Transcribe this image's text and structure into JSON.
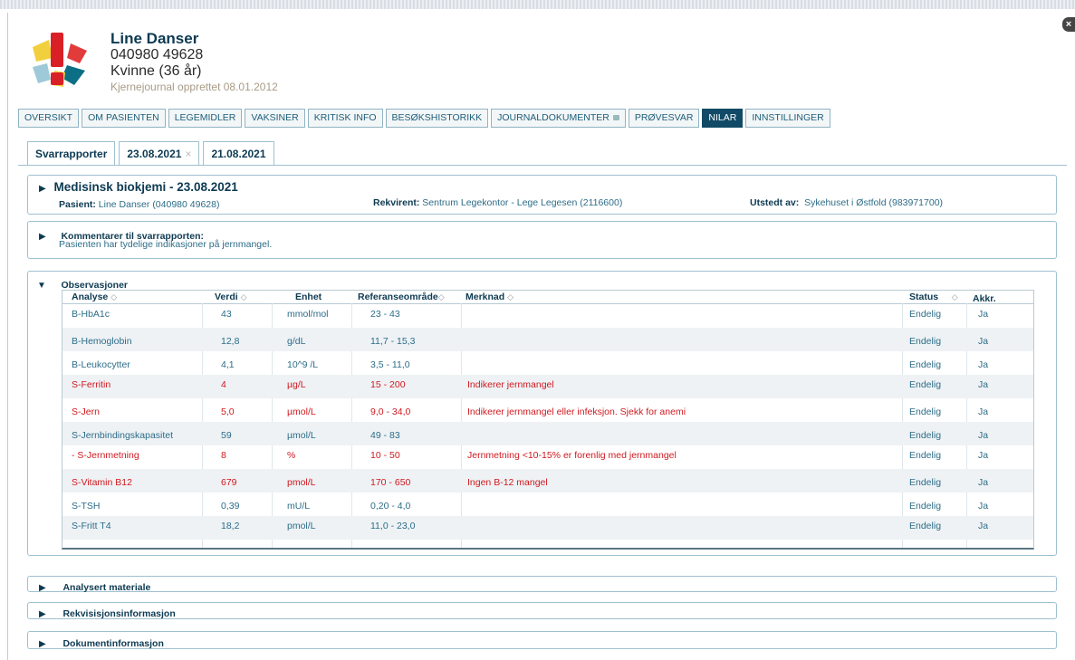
{
  "top": {
    "faded_text": "…"
  },
  "patient": {
    "name": "Line Danser",
    "id": "040980 49628",
    "gender_age": "Kvinne (36 år)",
    "journal": "Kjernejournal opprettet 08.01.2012"
  },
  "nav": [
    {
      "label": "OVERSIKT",
      "active": false
    },
    {
      "label": "OM PASIENTEN",
      "active": false
    },
    {
      "label": "LEGEMIDLER",
      "active": false
    },
    {
      "label": "VAKSINER",
      "active": false
    },
    {
      "label": "KRITISK INFO",
      "active": false
    },
    {
      "label": "BESØKSHISTORIKK",
      "active": false
    },
    {
      "label": "JOURNALDOKUMENTER",
      "active": false,
      "icon": "lock-icon"
    },
    {
      "label": "PRØVESVAR",
      "active": false
    },
    {
      "label": "NILAR",
      "active": true
    },
    {
      "label": "INNSTILLINGER",
      "active": false
    }
  ],
  "subtabs": [
    {
      "label": "Svarrapporter"
    },
    {
      "label": "23.08.2021",
      "close": "×"
    },
    {
      "label": "21.08.2021"
    }
  ],
  "report": {
    "title": "Medisinsk biokjemi - 23.08.2021",
    "patient_label": "Pasient:",
    "patient_value": "Line Danser (040980 49628)",
    "rekvirent_label": "Rekvirent:",
    "rekvirent_value": "Sentrum Legekontor - Lege Legesen (2116600)",
    "utstedt_label": "Utstedt av:",
    "utstedt_value": "Sykehuset i Østfold (983971700)"
  },
  "comments": {
    "title": "Kommentarer til svarrapporten:",
    "text": "Pasienten har tydelige indikasjoner på jernmangel."
  },
  "observations": {
    "title": "Observasjoner",
    "headers": {
      "analyse": "Analyse",
      "verdi": "Verdi",
      "enhet": "Enhet",
      "referanse": "Referanseområde",
      "merknad": "Merknad",
      "status": "Status",
      "akkr": "Akkr."
    },
    "sort_glyph": "◇",
    "rows": [
      {
        "name": "B-HbA1c",
        "value": "43",
        "unit": "mmol/mol",
        "ref": "23 - 43",
        "note": "",
        "status": "Endelig",
        "akkr": "Ja",
        "flag": false
      },
      {
        "name": "B-Hemoglobin",
        "value": "12,8",
        "unit": "g/dL",
        "ref": "11,7 - 15,3",
        "note": "",
        "status": "Endelig",
        "akkr": "Ja",
        "flag": false
      },
      {
        "name": "B-Leukocytter",
        "value": "4,1",
        "unit": "10^9 /L",
        "ref": "3,5 - 11,0",
        "note": "",
        "status": "Endelig",
        "akkr": "Ja",
        "flag": false
      },
      {
        "name": "S-Ferritin",
        "value": "4",
        "unit": "µg/L",
        "ref": "15 - 200",
        "note": "Indikerer jernmangel",
        "status": "Endelig",
        "akkr": "Ja",
        "flag": true
      },
      {
        "name": "S-Jern",
        "value": "5,0",
        "unit": "µmol/L",
        "ref": "9,0 - 34,0",
        "note": "Indikerer jernmangel eller infeksjon. Sjekk for anemi",
        "status": "Endelig",
        "akkr": "Ja",
        "flag": true
      },
      {
        "name": "S-Jernbindingskapasitet",
        "value": "59",
        "unit": "µmol/L",
        "ref": "49 - 83",
        "note": "",
        "status": "Endelig",
        "akkr": "Ja",
        "flag": false
      },
      {
        "name": " - S-Jernmetning",
        "value": "8",
        "unit": "%",
        "ref": "10 - 50",
        "note": "Jernmetning <10-15% er forenlig med jernmangel",
        "status": "Endelig",
        "akkr": "Ja",
        "flag": true
      },
      {
        "name": "S-Vitamin B12",
        "value": "679",
        "unit": "pmol/L",
        "ref": "170 - 650",
        "note": "Ingen B-12 mangel",
        "status": "Endelig",
        "akkr": "Ja",
        "flag": true
      },
      {
        "name": "S-TSH",
        "value": "0,39",
        "unit": "mU/L",
        "ref": "0,20 - 4,0",
        "note": "",
        "status": "Endelig",
        "akkr": "Ja",
        "flag": false
      },
      {
        "name": "S-Fritt T4",
        "value": "18,2",
        "unit": "pmol/L",
        "ref": "11,0 - 23,0",
        "note": "",
        "status": "Endelig",
        "akkr": "Ja",
        "flag": false
      }
    ]
  },
  "collapsed": [
    {
      "title": "Analysert materiale"
    },
    {
      "title": "Rekvisisjonsinformasjon"
    },
    {
      "title": "Dokumentinformasjon"
    }
  ],
  "colors": {
    "accent": "#0d3a52",
    "active_tab": "#114a66",
    "link": "#2d6d88",
    "alert": "#d0191f"
  }
}
